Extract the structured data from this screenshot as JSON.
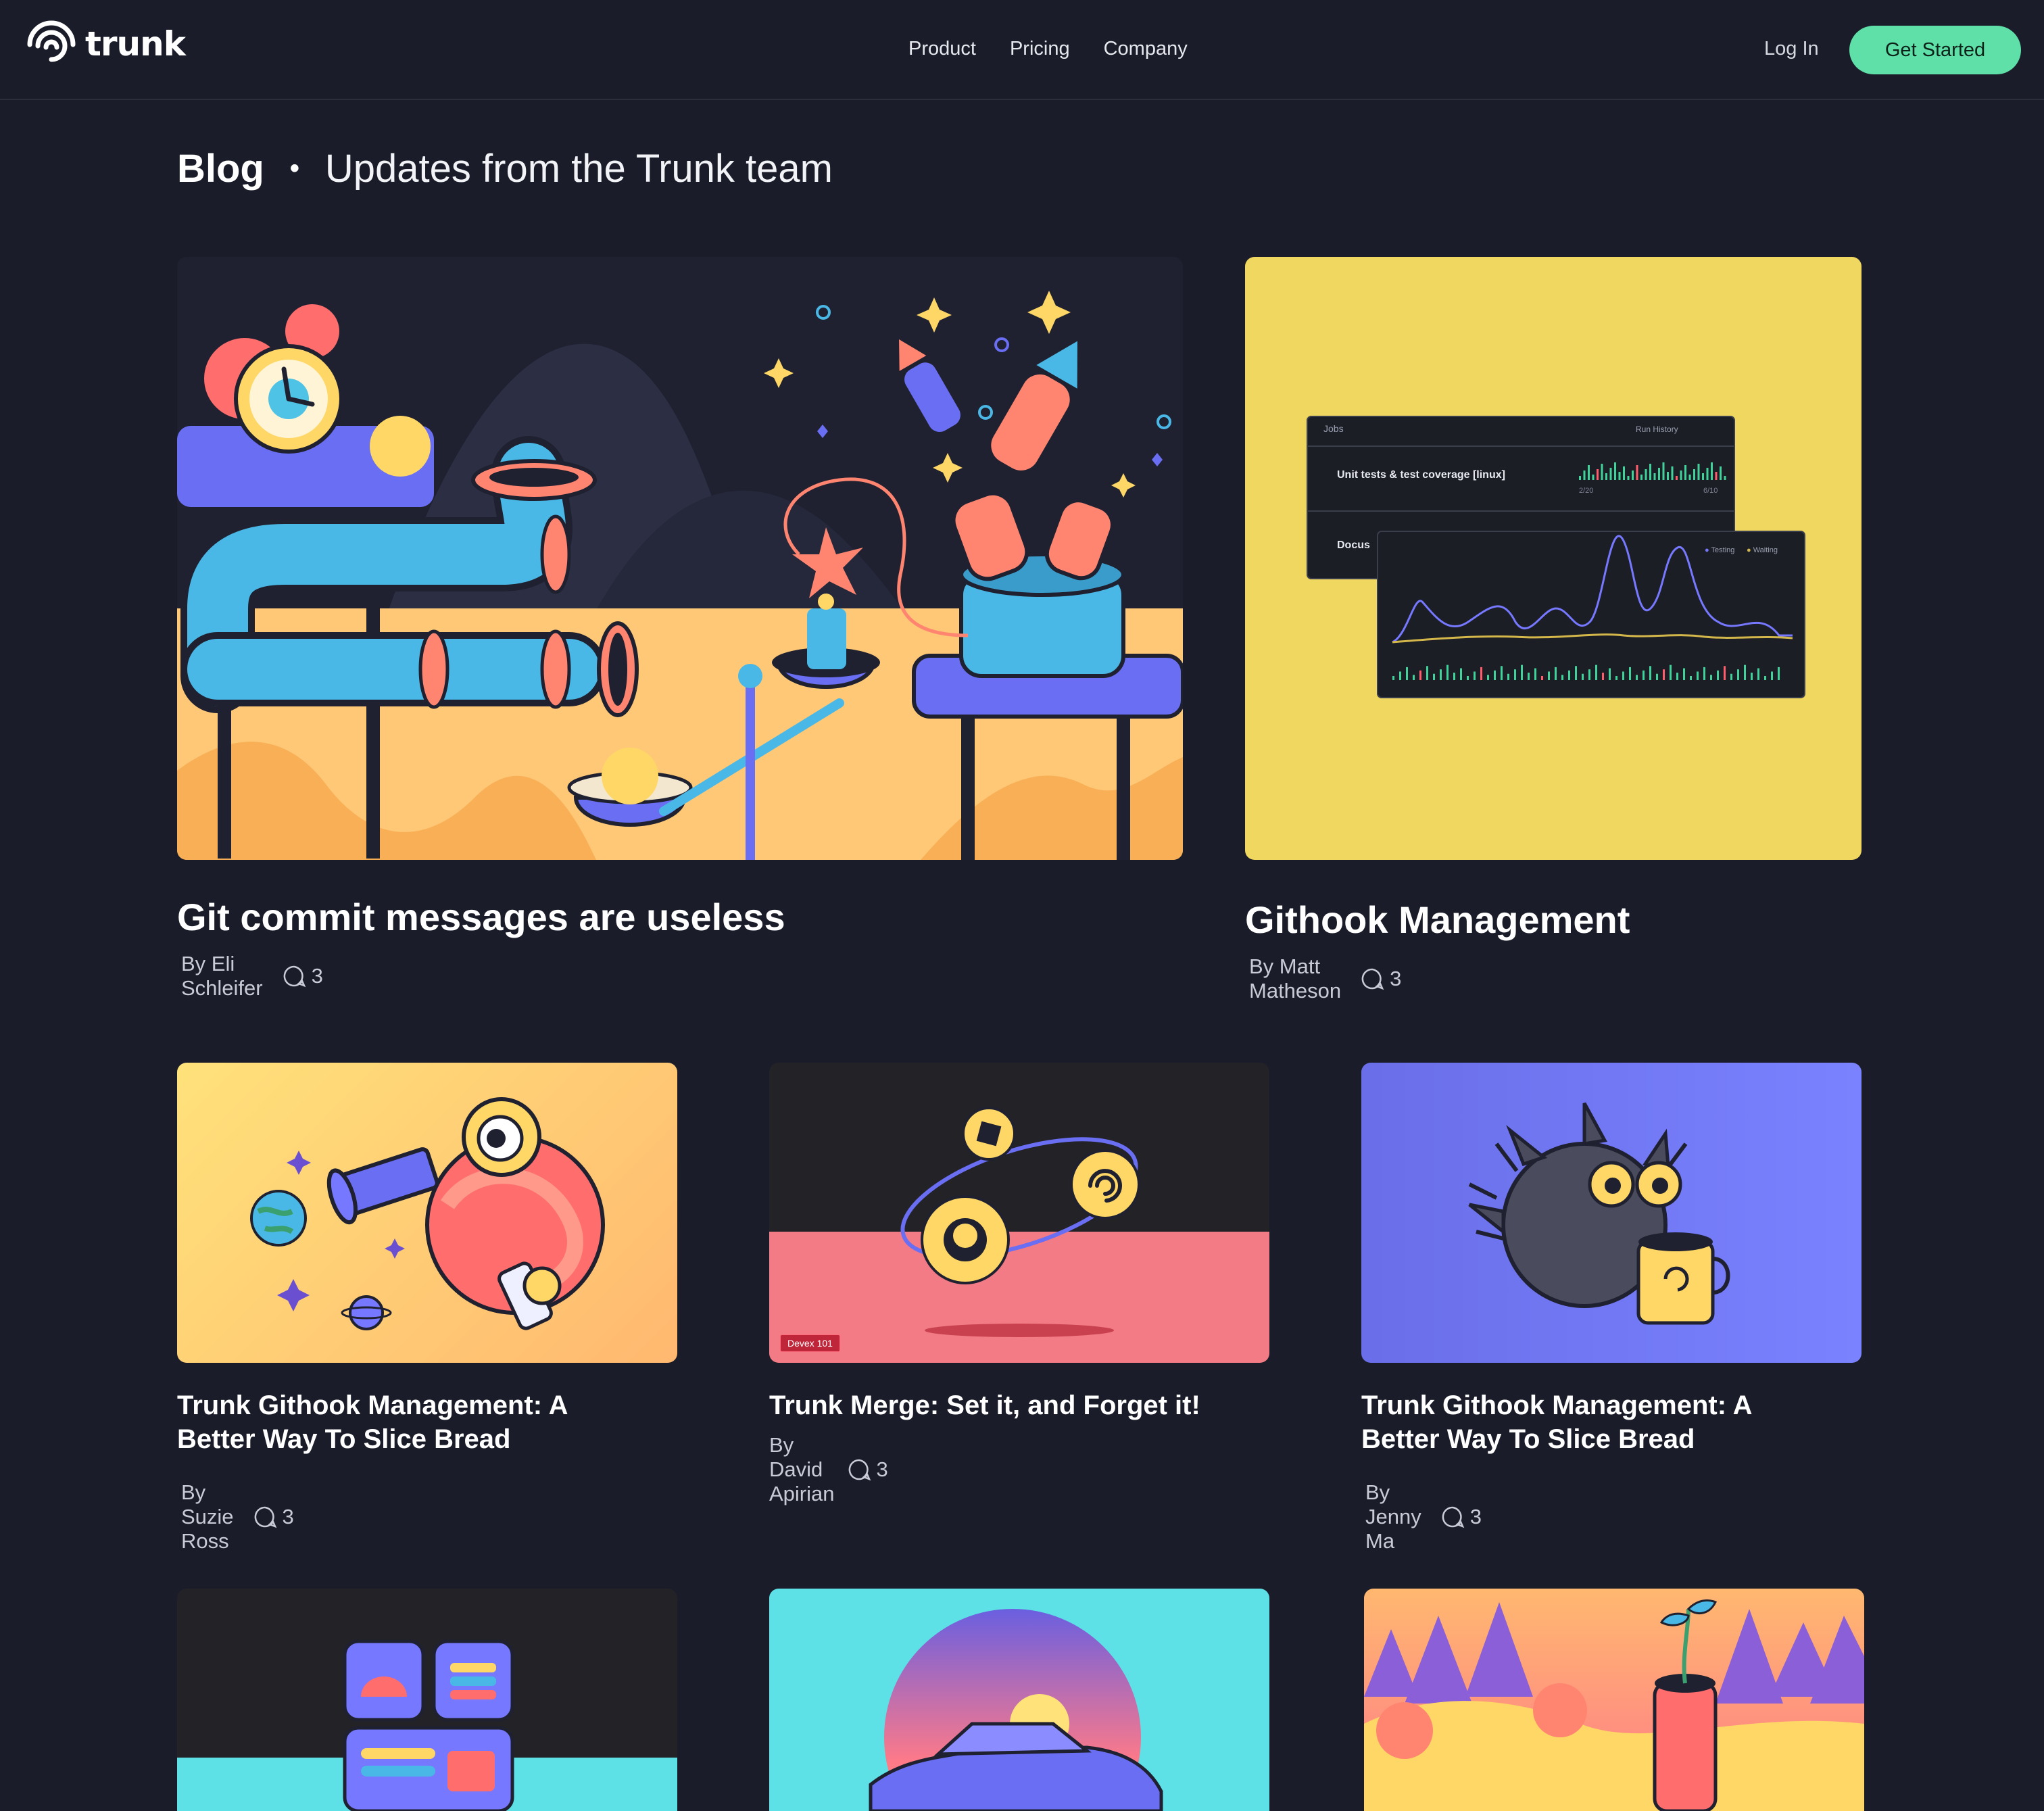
{
  "header": {
    "logo_text": "trunk",
    "nav": [
      "Product",
      "Pricing",
      "Company"
    ],
    "login_label": "Log In",
    "cta_label": "Get Started"
  },
  "page": {
    "title": "Blog",
    "separator": "•",
    "subtitle": "Updates from the Trunk team"
  },
  "featured": [
    {
      "title": "Git commit messages are useless",
      "author": "By Eli Schleifer",
      "comments": "3"
    },
    {
      "title": "Githook Management",
      "author": "By Matt Matheson",
      "comments": "3"
    }
  ],
  "posts": [
    {
      "title_line1": "Trunk Githook Management: A",
      "title_line2": "Better Way To Slice Bread",
      "author": "By Suzie Ross",
      "comments": "3"
    },
    {
      "title_line1": "Trunk Merge: Set it, and Forget it!",
      "title_line2": "",
      "author": "By David Apirian",
      "comments": "3",
      "badge": "Devex 101"
    },
    {
      "title_line1": "Trunk Githook Management: A",
      "title_line2": "Better Way To Slice Bread",
      "author": "By Jenny Ma",
      "comments": "3"
    }
  ],
  "githook_dashboard": {
    "jobs_label": "Jobs",
    "run_history_label": "Run History",
    "row1": "Unit tests & test coverage [linux]",
    "row2": "Docus",
    "date_start": "2/20",
    "date_end": "6/10",
    "legend": [
      "Testing",
      "Waiting"
    ]
  },
  "colors": {
    "background": "#1a1d29",
    "accent": "#5fe0a8",
    "yellow_card": "#f0d760",
    "purple_card": "#6b6ee8"
  }
}
